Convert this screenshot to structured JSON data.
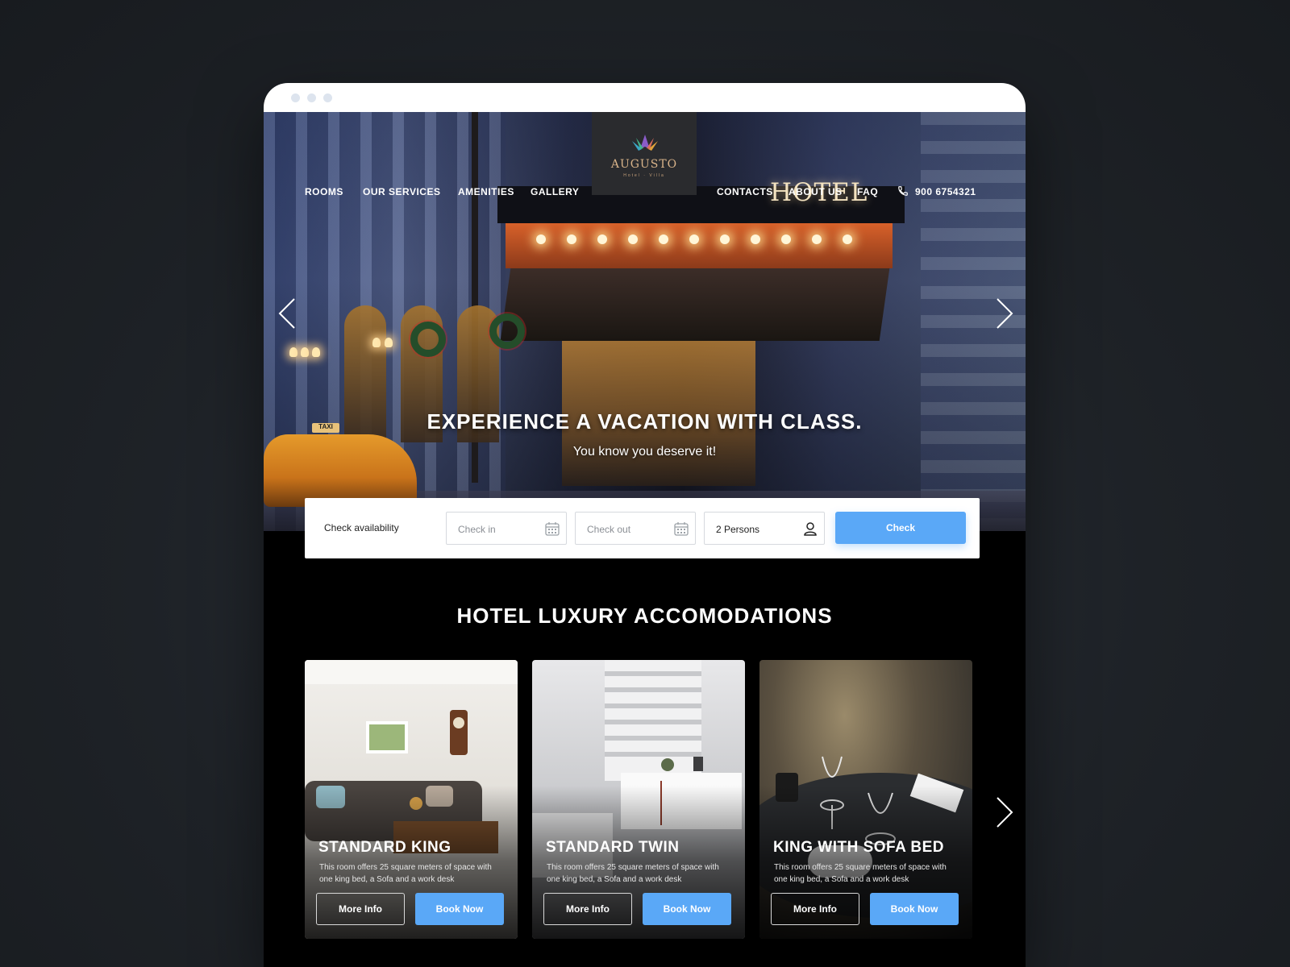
{
  "nav": {
    "left": [
      "ROOMS",
      "OUR SERVICES",
      "AMENITIES",
      "GALLERY"
    ],
    "right": [
      "CONTACTS",
      "ABOUT US",
      "FAQ"
    ],
    "phone": "900 6754321"
  },
  "logo": {
    "name": "AUGUSTO",
    "sub": "Hotel · Villa"
  },
  "hero": {
    "sign": "HOTEL",
    "taxi": "TAXI",
    "title": "EXPERIENCE A VACATION WITH CLASS.",
    "subtitle": "You know you deserve it!"
  },
  "availability": {
    "label": "Check availability",
    "check_in_placeholder": "Check in",
    "check_out_placeholder": "Check out",
    "persons": "2 Persons",
    "button": "Check"
  },
  "section": {
    "title": "HOTEL LUXURY ACCOMODATIONS"
  },
  "rooms": [
    {
      "title": "STANDARD KING",
      "desc": "This room offers 25 square meters of space with one king bed, a Sofa and a work desk",
      "more": "More Info",
      "book": "Book Now"
    },
    {
      "title": "STANDARD TWIN",
      "desc": "This room offers 25 square meters of space with one king bed, a Sofa and a work desk",
      "more": "More Info",
      "book": "Book Now"
    },
    {
      "title": "KING WITH SOFA BED",
      "desc": "This room offers 25 square meters of space with one king bed, a Sofa and a work desk",
      "more": "More Info",
      "book": "Book Now"
    }
  ],
  "colors": {
    "accent": "#5aa8f7",
    "page_bg": "#1e2227",
    "section_bg": "#000000",
    "logo_gold": "#d9b48a"
  }
}
